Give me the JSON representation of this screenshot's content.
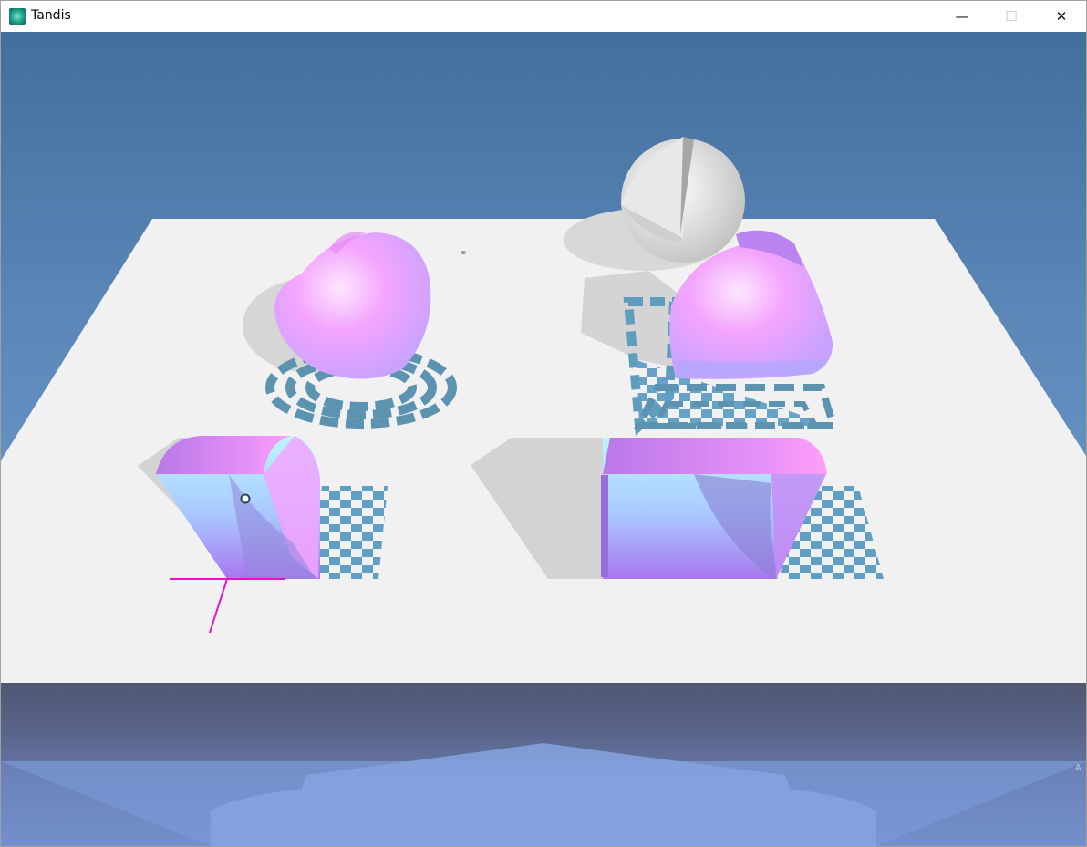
{
  "window": {
    "title": "Tandis",
    "controls": {
      "minimize": "—",
      "maximize": "☐",
      "close": "✕"
    }
  },
  "icons": [
    "app-icon",
    "minimize-icon",
    "maximize-icon",
    "close-icon"
  ],
  "colors": {
    "sky": "#5f8cc2",
    "table": "#f1f1f1",
    "shape_pink": "#f39bff",
    "shape_violet": "#a77af3",
    "shape_cyan": "#bdf3ff",
    "pattern": "#5e93b1",
    "checker_light": "#6fb3da",
    "axis": "#e514c7"
  }
}
